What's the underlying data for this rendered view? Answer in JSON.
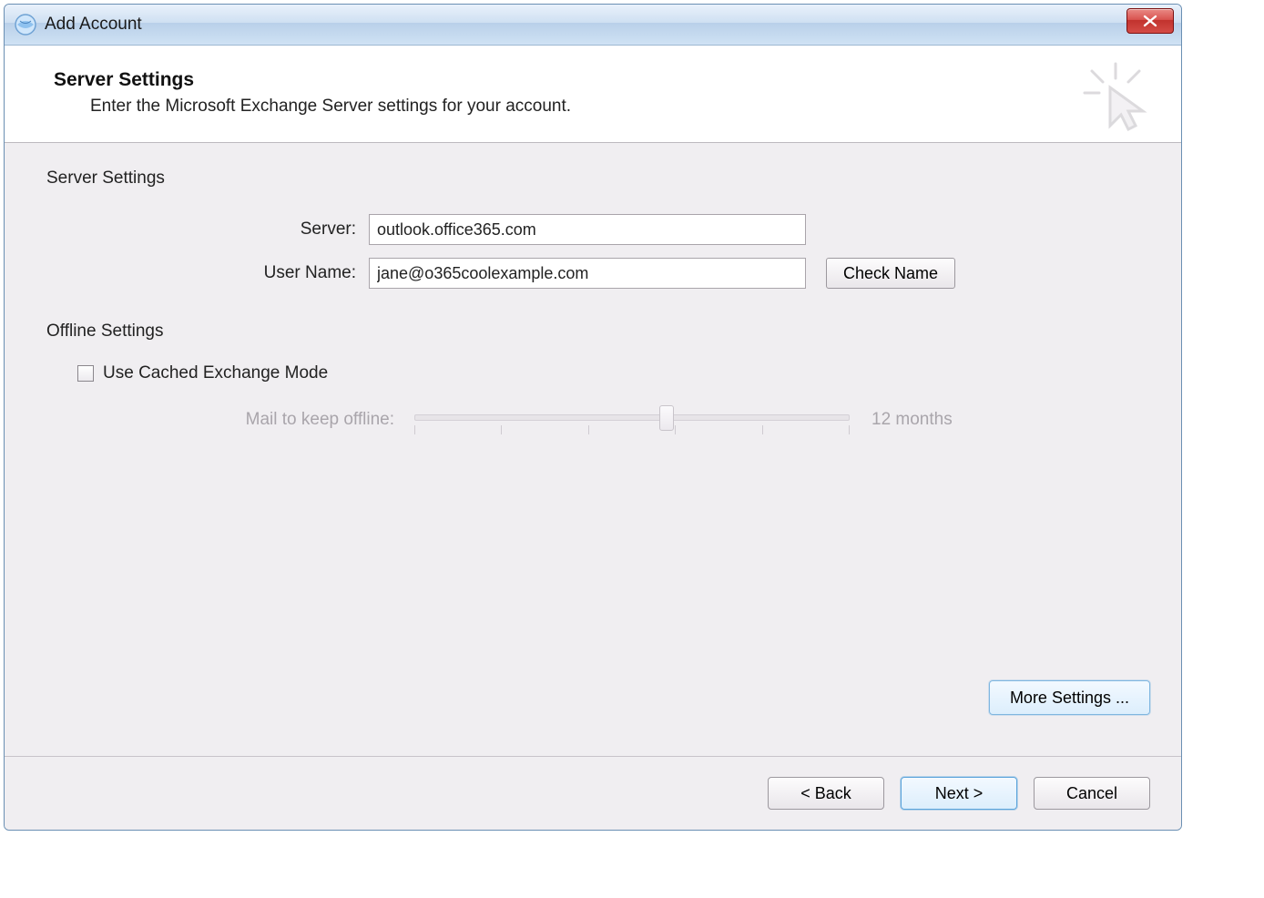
{
  "window": {
    "title": "Add Account"
  },
  "header": {
    "title": "Server Settings",
    "description": "Enter the Microsoft Exchange Server settings for your account."
  },
  "server_settings": {
    "group_label": "Server Settings",
    "server_label": "Server:",
    "server_value": "outlook.office365.com",
    "username_label": "User Name:",
    "username_value": "jane@o365coolexample.com",
    "check_name_label": "Check Name"
  },
  "offline_settings": {
    "group_label": "Offline Settings",
    "checkbox_label": "Use Cached Exchange Mode",
    "checkbox_checked": false,
    "slider_label": "Mail to keep offline:",
    "slider_value_label": "12 months"
  },
  "buttons": {
    "more_settings": "More Settings ...",
    "back": "< Back",
    "next": "Next >",
    "cancel": "Cancel"
  }
}
